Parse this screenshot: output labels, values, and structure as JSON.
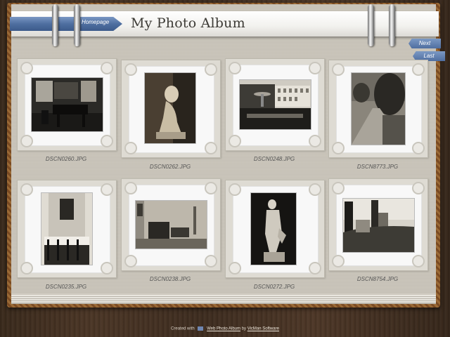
{
  "header": {
    "title": "My Photo Album",
    "homepage_label": "Homepage"
  },
  "nav": {
    "next_label": "Next",
    "last_label": "Last"
  },
  "photos": [
    {
      "filename": "DSCN0260.JPG",
      "icon": "photo-interior-piano"
    },
    {
      "filename": "DSCN0262.JPG",
      "icon": "photo-statue-seated"
    },
    {
      "filename": "DSCN0248.JPG",
      "icon": "photo-palace-fountain"
    },
    {
      "filename": "DSCN8773.JPG",
      "icon": "photo-garden-path"
    },
    {
      "filename": "DSCN0235.JPG",
      "icon": "photo-dining-room"
    },
    {
      "filename": "DSCN0238.JPG",
      "icon": "photo-interior-room"
    },
    {
      "filename": "DSCN0272.JPG",
      "icon": "photo-statue-standing"
    },
    {
      "filename": "DSCN8754.JPG",
      "icon": "photo-tower-landscape"
    }
  ],
  "footer": {
    "created_with": "Created with",
    "app_link": "Web Photo Album",
    "by": "by",
    "company_link": "VicMan Software"
  },
  "colors": {
    "ribbon": "#4f6fa0",
    "page": "#c9c4b9",
    "wood": "#3e2d20"
  }
}
